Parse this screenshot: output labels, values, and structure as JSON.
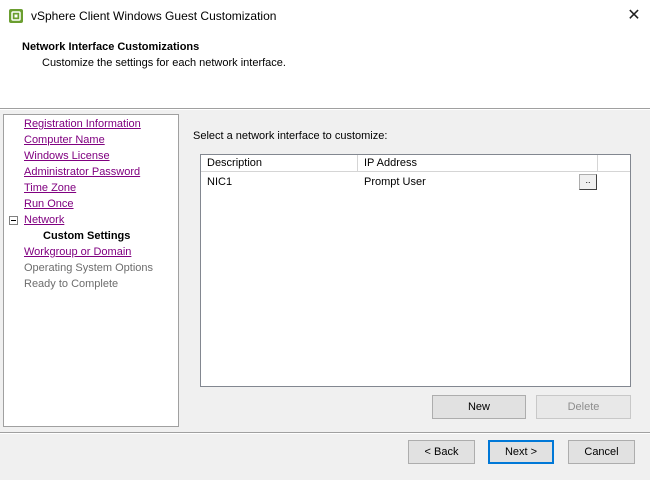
{
  "window": {
    "title": "vSphere Client Windows Guest Customization",
    "app_icon": "vsphere-client-icon",
    "close_glyph": "✕"
  },
  "header": {
    "title": "Network Interface Customizations",
    "subtitle": "Customize the settings for each network interface."
  },
  "nav": {
    "items": [
      {
        "label": "Registration Information",
        "state": "link"
      },
      {
        "label": "Computer Name",
        "state": "link"
      },
      {
        "label": "Windows License",
        "state": "link"
      },
      {
        "label": "Administrator Password",
        "state": "link"
      },
      {
        "label": "Time Zone",
        "state": "link"
      },
      {
        "label": "Run Once",
        "state": "link"
      },
      {
        "label": "Network",
        "state": "link-expanded"
      },
      {
        "label": "Custom Settings",
        "state": "current"
      },
      {
        "label": "Workgroup or Domain",
        "state": "link"
      },
      {
        "label": "Operating System Options",
        "state": "disabled"
      },
      {
        "label": "Ready to Complete",
        "state": "disabled"
      }
    ]
  },
  "main": {
    "prompt": "Select a network interface to customize:",
    "table": {
      "columns": [
        "Description",
        "IP Address"
      ],
      "rows": [
        {
          "description": "NIC1",
          "ip_address": "Prompt User",
          "action_label": ".."
        }
      ]
    },
    "new_label": "New",
    "delete_label": "Delete"
  },
  "footer": {
    "back_label": "< Back",
    "next_label": "Next >",
    "cancel_label": "Cancel"
  }
}
